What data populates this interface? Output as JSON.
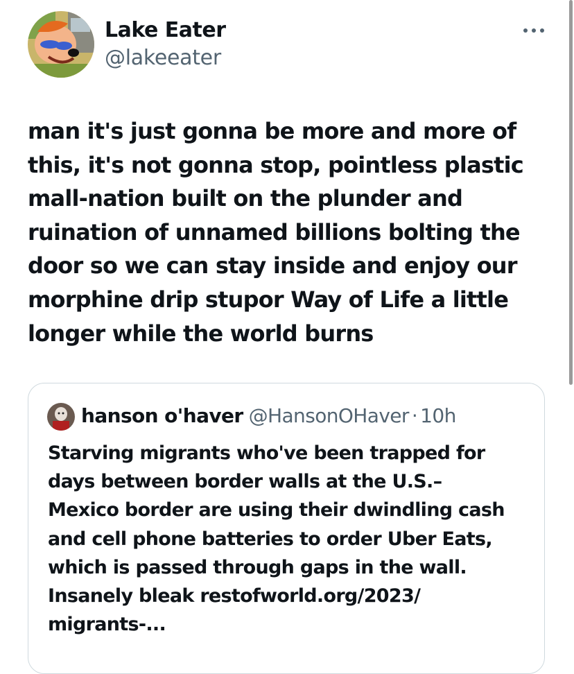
{
  "author": {
    "display_name": "Lake Eater",
    "handle": "@lakeeater"
  },
  "tweet": {
    "text": "man it's just gonna be more and more of\nthis, it's not gonna stop, pointless plastic\nmall-nation built on the plunder and\nruination of unnamed billions bolting the\ndoor so we can stay inside and enjoy our\nmorphine drip stupor Way of Life a little\nlonger while the world burns"
  },
  "quoted": {
    "display_name": "hanson o'haver",
    "handle": "@HansonOHaver",
    "separator": "·",
    "time": "10h",
    "text": "Starving migrants who've been trapped for\ndays between border walls at the U.S.–\nMexico border are using their dwindling cash\nand cell phone batteries to order Uber Eats,\nwhich is passed through gaps in the wall.\nInsanely bleak restofworld.org/2023/\nmigrants-..."
  },
  "icons": {
    "more": "more-horizontal-icon"
  },
  "colors": {
    "text_primary": "#0f1419",
    "text_secondary": "#536471",
    "border": "#cfd9de"
  }
}
